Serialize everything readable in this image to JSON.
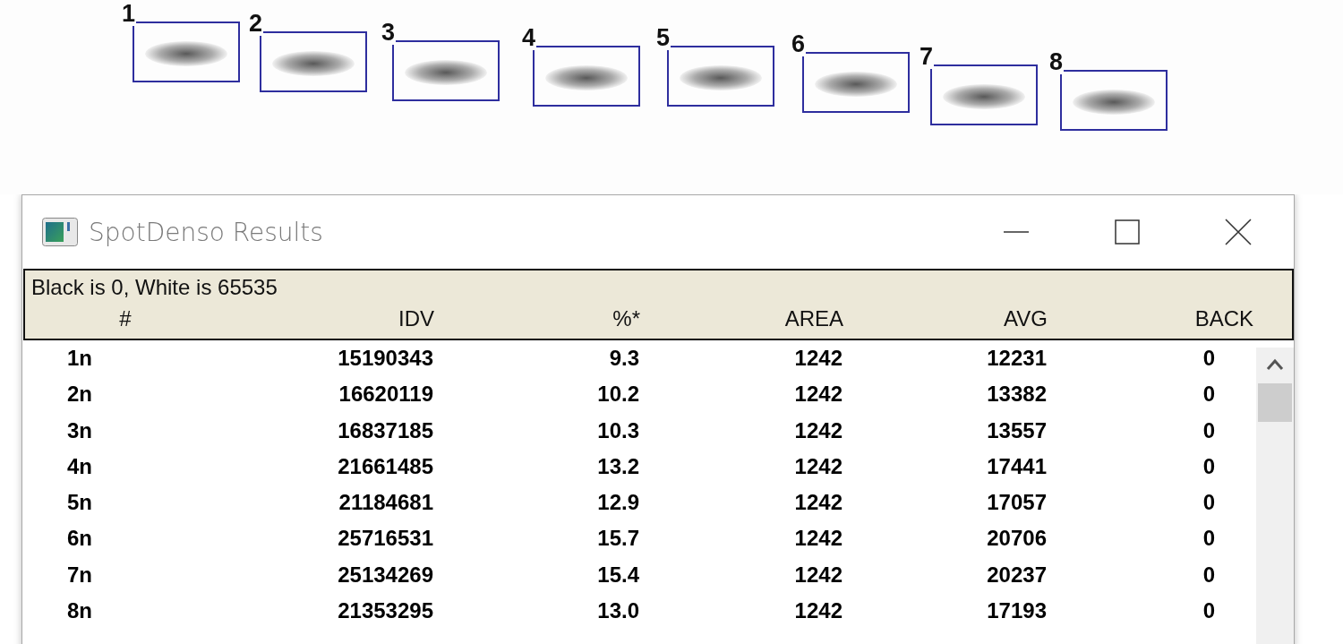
{
  "blot": {
    "lanes": [
      {
        "label": "1"
      },
      {
        "label": "2"
      },
      {
        "label": "3"
      },
      {
        "label": "4"
      },
      {
        "label": "5"
      },
      {
        "label": "6"
      },
      {
        "label": "7"
      },
      {
        "label": "8"
      }
    ]
  },
  "window": {
    "title": "SpotDenso Results"
  },
  "info": {
    "scale_note": "Black is 0, White is 65535"
  },
  "table": {
    "columns": [
      "#",
      "IDV",
      "%*",
      "AREA",
      "AVG",
      "BACK"
    ],
    "rows": [
      [
        "1n",
        "15190343",
        "9.3",
        "1242",
        "12231",
        "0"
      ],
      [
        "2n",
        "16620119",
        "10.2",
        "1242",
        "13382",
        "0"
      ],
      [
        "3n",
        "16837185",
        "10.3",
        "1242",
        "13557",
        "0"
      ],
      [
        "4n",
        "21661485",
        "13.2",
        "1242",
        "17441",
        "0"
      ],
      [
        "5n",
        "21184681",
        "12.9",
        "1242",
        "17057",
        "0"
      ],
      [
        "6n",
        "25716531",
        "15.7",
        "1242",
        "20706",
        "0"
      ],
      [
        "7n",
        "25134269",
        "15.4",
        "1242",
        "20237",
        "0"
      ],
      [
        "8n",
        "21353295",
        "13.0",
        "1242",
        "17193",
        "0"
      ]
    ]
  }
}
